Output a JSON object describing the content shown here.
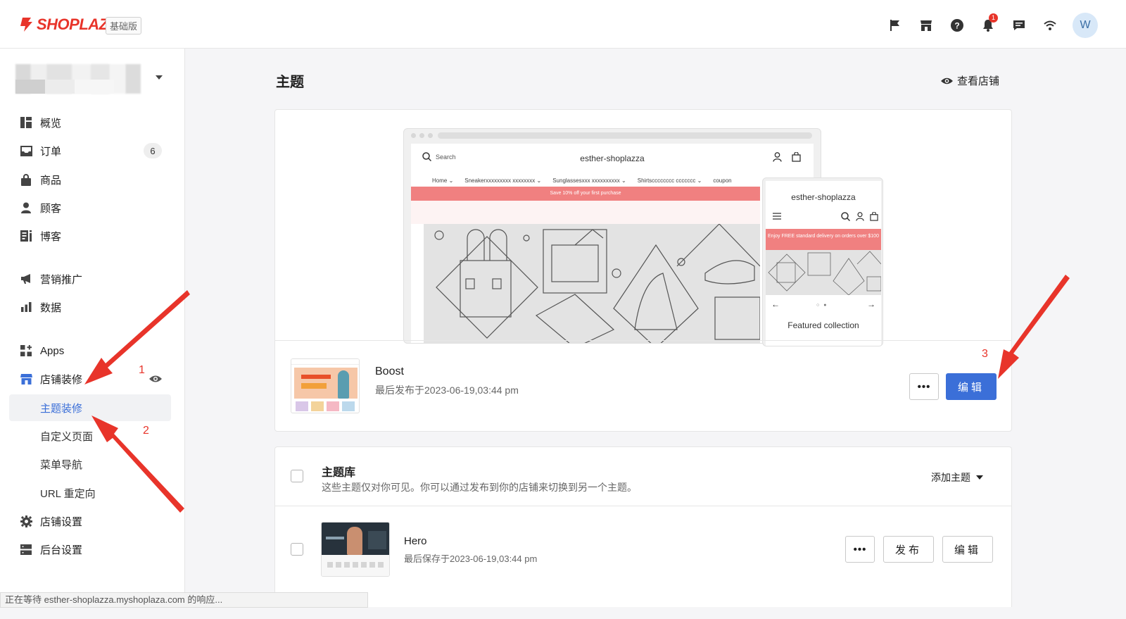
{
  "brand": {
    "name": "SHOPLAZZA",
    "plan": "基础版"
  },
  "header_icons": [
    "flag-icon",
    "store-icon",
    "help-icon",
    "bell-icon",
    "chat-icon",
    "wifi-icon"
  ],
  "notifications_count": "1",
  "user": {
    "initial": "W"
  },
  "sidebar": {
    "items": [
      {
        "label": "概览",
        "icon": "dashboard-icon"
      },
      {
        "label": "订单",
        "icon": "inbox-icon",
        "badge": "6"
      },
      {
        "label": "商品",
        "icon": "bag-icon"
      },
      {
        "label": "顾客",
        "icon": "person-icon"
      },
      {
        "label": "博客",
        "icon": "blog-icon"
      },
      {
        "label": "营销推广",
        "icon": "megaphone-icon"
      },
      {
        "label": "数据",
        "icon": "bar-chart-icon"
      },
      {
        "label": "Apps",
        "icon": "apps-icon"
      },
      {
        "label": "店铺装修",
        "icon": "storefront-icon"
      },
      {
        "label": "店铺设置",
        "icon": "gear-icon"
      },
      {
        "label": "后台设置",
        "icon": "server-icon"
      }
    ],
    "sub_items": [
      "主题装修",
      "自定义页面",
      "菜单导航",
      "URL 重定向"
    ]
  },
  "main": {
    "title": "主题",
    "view_store": "查看店铺"
  },
  "preview": {
    "store_name": "esther-shoplazza",
    "search": "Search",
    "nav": [
      "Home ⌄",
      "Sneakerxxxxxxxxx xxxxxxxx ⌄",
      "Sunglassesxxx xxxxxxxxxx ⌄",
      "Shirtscccccccc ccccccc ⌄",
      "coupon"
    ],
    "desktop_banner": "Save 10% off your first purchase",
    "mobile_banner": "Enjoy FREE standard delivery on orders over $100",
    "featured": "Featured collection"
  },
  "current_theme": {
    "name": "Boost",
    "date": "最后发布于2023-06-19,03:44 pm",
    "more": "•••",
    "edit": "编辑"
  },
  "library": {
    "title": "主题库",
    "subtitle": "这些主题仅对你可见。你可以通过发布到你的店铺来切换到另一个主题。",
    "add": "添加主题",
    "themes": [
      {
        "name": "Hero",
        "date": "最后保存于2023-06-19,03:44 pm",
        "more": "•••",
        "publish": "发布",
        "edit": "编辑"
      }
    ]
  },
  "annotations": [
    "1",
    "2",
    "3"
  ],
  "status": "正在等待 esther-shoplazza.myshoplaza.com 的响应...",
  "colors": {
    "accent": "#3b6fd8",
    "brand": "#e8342a",
    "annotation": "#e8342a"
  }
}
